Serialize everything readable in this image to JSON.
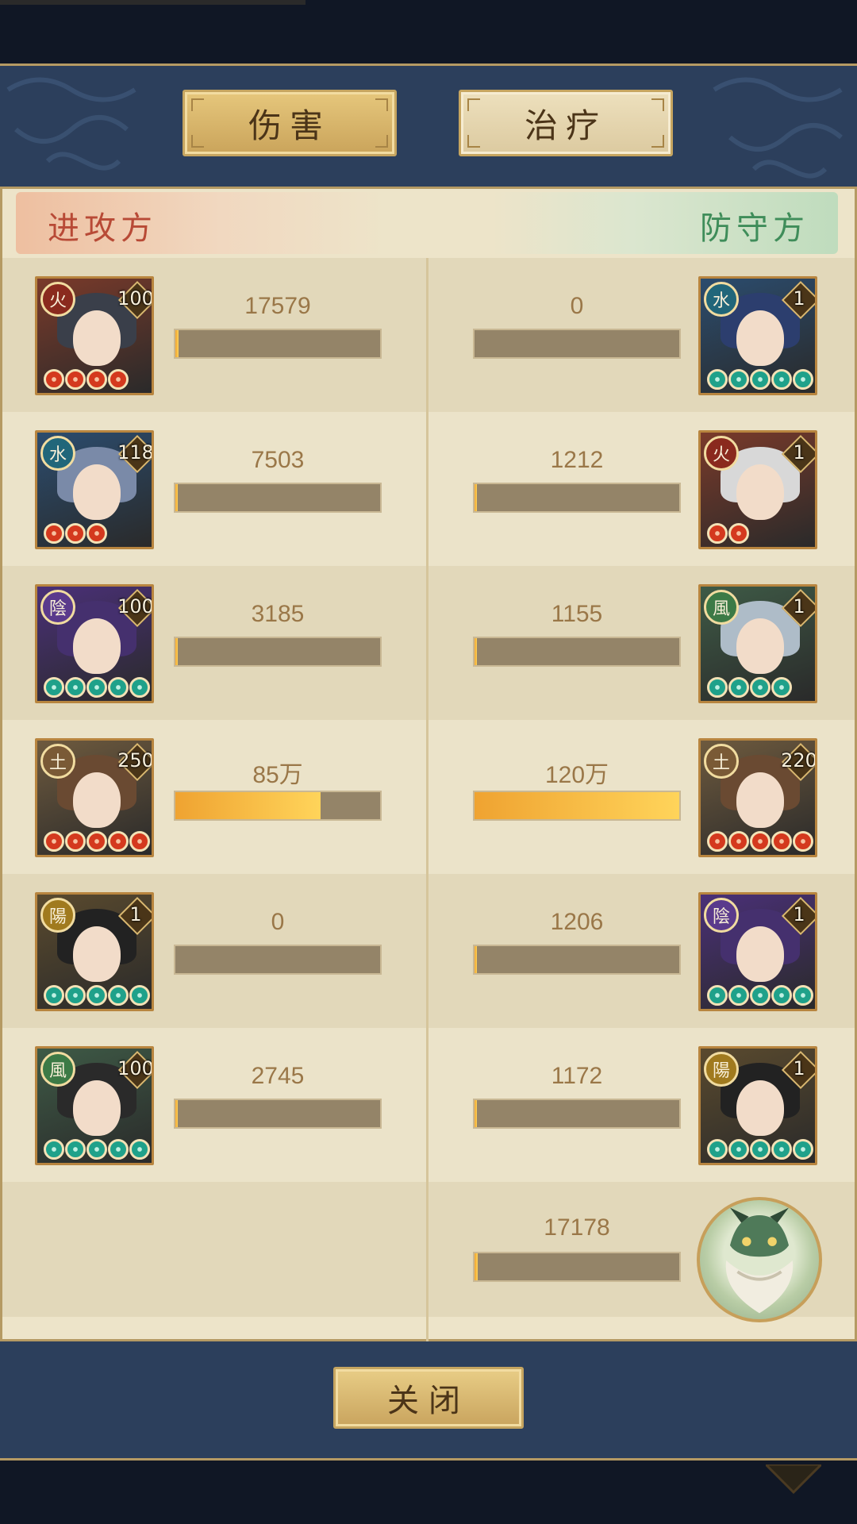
{
  "tabs": {
    "damage": "伤害",
    "healing": "治疗",
    "active": "damage"
  },
  "sides": {
    "attacker": "进攻方",
    "defender": "防守方"
  },
  "rows": [
    {
      "attacker": {
        "element": "火",
        "level": "100",
        "stars": 4,
        "star_color": "red",
        "value": "17579",
        "ratio": 0.015
      },
      "defender": {
        "element": "水",
        "level": "1",
        "stars": 5,
        "star_color": "teal",
        "value": "0",
        "ratio": 0
      }
    },
    {
      "attacker": {
        "element": "水",
        "level": "118",
        "stars": 3,
        "star_color": "red",
        "value": "7503",
        "ratio": 0.006
      },
      "defender": {
        "element": "火",
        "level": "1",
        "stars": 2,
        "star_color": "red",
        "value": "1212",
        "ratio": 0.001
      }
    },
    {
      "attacker": {
        "element": "陰",
        "level": "100",
        "stars": 5,
        "star_color": "teal",
        "value": "3185",
        "ratio": 0.003
      },
      "defender": {
        "element": "風",
        "level": "1",
        "stars": 4,
        "star_color": "teal",
        "value": "1155",
        "ratio": 0.001
      }
    },
    {
      "attacker": {
        "element": "土",
        "level": "250",
        "stars": 5,
        "star_color": "red",
        "value": "85万",
        "ratio": 0.71
      },
      "defender": {
        "element": "土",
        "level": "220",
        "stars": 5,
        "star_color": "red",
        "value": "120万",
        "ratio": 1.0
      }
    },
    {
      "attacker": {
        "element": "陽",
        "level": "1",
        "stars": 5,
        "star_color": "teal",
        "value": "0",
        "ratio": 0
      },
      "defender": {
        "element": "陰",
        "level": "1",
        "stars": 5,
        "star_color": "teal",
        "value": "1206",
        "ratio": 0.001
      }
    },
    {
      "attacker": {
        "element": "風",
        "level": "100",
        "stars": 5,
        "star_color": "teal",
        "value": "2745",
        "ratio": 0.002
      },
      "defender": {
        "element": "陽",
        "level": "1",
        "stars": 5,
        "star_color": "teal",
        "value": "1172",
        "ratio": 0.001
      }
    }
  ],
  "beast": {
    "value": "17178",
    "ratio": 0.015
  },
  "close_label": "关闭",
  "colors": {
    "panel": "#2c3f5c",
    "content": "#ede4c9",
    "bar_track": "#948468",
    "bar_fill": "#efa331",
    "attacker": "#b84a36",
    "defender": "#3f8d5a"
  },
  "element_colors": {
    "火": "#8a2a1e",
    "水": "#21667a",
    "陰": "#5a3a8c",
    "土": "#7a5a36",
    "陽": "#a07a1e",
    "風": "#3c7a46"
  }
}
